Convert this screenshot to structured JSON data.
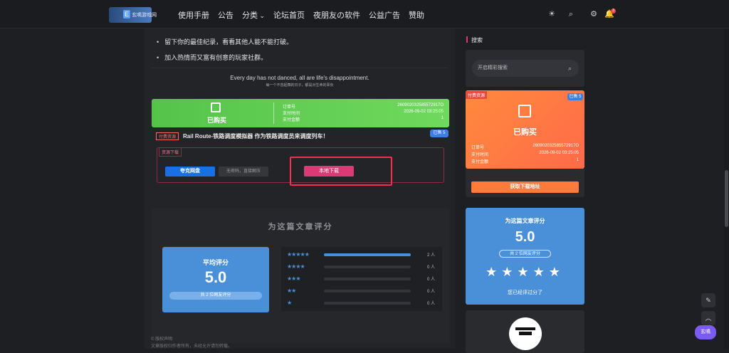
{
  "header": {
    "logo_text": "玄鳴游戏网",
    "logo_badge": "E",
    "nav": [
      "使用手册",
      "公告",
      "分类",
      "论坛首页",
      "夜朋友の软件",
      "公益广告",
      "赞助"
    ],
    "notif_count": "3"
  },
  "article": {
    "bullets": [
      "留下你的最佳纪录，看看其他人能不能打破。",
      "加入热情而又富有创意的玩家社群。"
    ],
    "quote_en": "Every day has not danced, all are life's disappointment.",
    "quote_cn": "每一个不曾起舞的日子，都是对生命的辜负"
  },
  "purchase": {
    "status": "已购买",
    "order_label": "订单号",
    "order_no": "260902032585572917O",
    "time_label": "支付时间",
    "time_value": "2026-09-02 03:25:05",
    "amount_label": "支付金额",
    "amount_value": "1",
    "paid_tag": "付费资源",
    "title": "Rail Route-铁路调度模拟器 作为铁路调度员来调度列车！",
    "sold": "已售 5"
  },
  "download": {
    "head": "资源下载",
    "quark": "夸克网盘",
    "note": "无密码，直接解压",
    "local": "本地下载"
  },
  "rating": {
    "title": "为这篇文章评分",
    "avg_label": "平均评分",
    "avg_value": "5.0",
    "count_text": "共 2 位网友评分",
    "rows": [
      {
        "stars": "★★★★★",
        "fill": 1.0,
        "count": "2 人"
      },
      {
        "stars": "★★★★",
        "fill": 0,
        "count": "0 人"
      },
      {
        "stars": "★★★",
        "fill": 0,
        "count": "0 人"
      },
      {
        "stars": "★★",
        "fill": 0,
        "count": "0 人"
      },
      {
        "stars": "★",
        "fill": 0,
        "count": "0 人"
      }
    ]
  },
  "footer": {
    "line1": "© 版权声明",
    "line2": "文章版权归作者所有，未经允许请勿转载。"
  },
  "sidebar": {
    "search_heading": "搜索",
    "search_placeholder": "开启精彩搜索",
    "order": {
      "tag": "付费资源",
      "sold": "已售 5",
      "status": "已购买",
      "order_label": "订单号",
      "order_no": "260902032585572917O",
      "time_label": "支付时间",
      "time_value": "2026-09-02 03:25:05",
      "amount_label": "支付金额",
      "amount_value": "1",
      "button": "获取下载地址"
    },
    "rate": {
      "title": "为这篇文章评分",
      "value": "5.0",
      "count_text": "共 2 位网友评分",
      "stars": "★★★★★",
      "done": "您已经评过分了"
    }
  },
  "float": {
    "purple": "玄鳴"
  }
}
